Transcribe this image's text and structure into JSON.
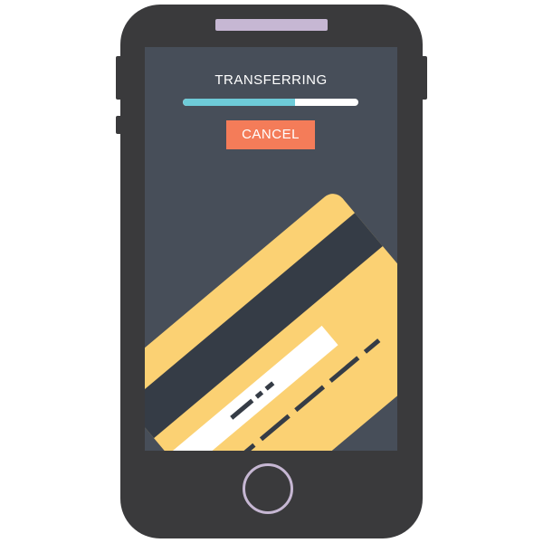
{
  "transfer": {
    "status_text": "TRANSFERRING",
    "progress_percent": 64,
    "cancel_label": "CANCEL"
  },
  "icons": {
    "card": "credit-card-icon",
    "home": "home-button-icon"
  },
  "colors": {
    "phone_body": "#3a3a3c",
    "screen": "#474e59",
    "progress_fill": "#6ecbd8",
    "progress_track": "#ffffff",
    "cancel_button": "#f47c59",
    "card": "#fbd173",
    "card_stripe": "#353c46",
    "accent_lavender": "#c6b7d3"
  }
}
